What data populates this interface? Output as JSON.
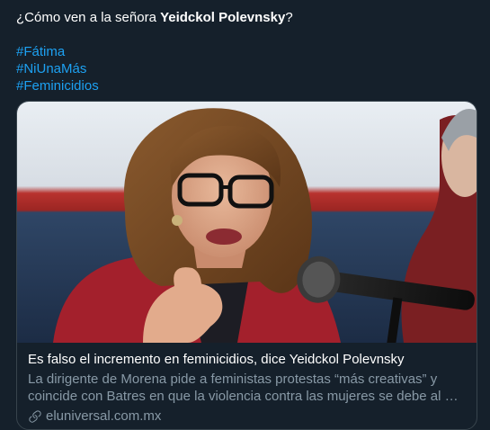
{
  "tweet": {
    "text_prefix": "¿Cómo ven a la señora ",
    "text_bold": "Yeidckol Polevnsky",
    "text_suffix": "?",
    "hashtags": [
      "#Fátima",
      "#NiUnaMás",
      "#Feminicidios"
    ]
  },
  "card": {
    "title": "Es falso el incremento en feminicidios, dice Yeidckol Polevnsky",
    "description_lines": [
      "La dirigente de Morena pide a feministas protestas “más creativas” y",
      "coincide con Batres en que la violencia contra las mujeres se debe al …"
    ],
    "domain": "eluniversal.com.mx",
    "image_icon": "news-photo-woman-speaking-at-microphone"
  },
  "colors": {
    "background": "#15202b",
    "link": "#1da1f2",
    "secondary_text": "#8899a6",
    "border": "#38444d"
  }
}
